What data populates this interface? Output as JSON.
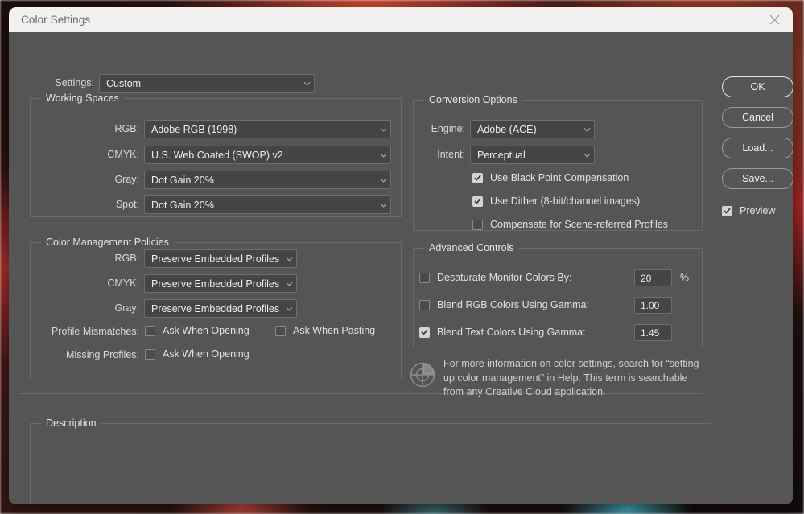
{
  "window": {
    "title": "Color Settings",
    "close_icon": "close-icon"
  },
  "settings_row": {
    "label": "Settings:",
    "value": "Custom"
  },
  "working_spaces": {
    "legend": "Working Spaces",
    "rows": [
      {
        "label": "RGB:",
        "value": "Adobe RGB (1998)"
      },
      {
        "label": "CMYK:",
        "value": "U.S. Web Coated (SWOP) v2"
      },
      {
        "label": "Gray:",
        "value": "Dot Gain 20%"
      },
      {
        "label": "Spot:",
        "value": "Dot Gain 20%"
      }
    ]
  },
  "color_management_policies": {
    "legend": "Color Management Policies",
    "rows": [
      {
        "label": "RGB:",
        "value": "Preserve Embedded Profiles"
      },
      {
        "label": "CMYK:",
        "value": "Preserve Embedded Profiles"
      },
      {
        "label": "Gray:",
        "value": "Preserve Embedded Profiles"
      }
    ],
    "profile_mismatches": {
      "label": "Profile Mismatches:",
      "ask_when_opening": {
        "label": "Ask When Opening",
        "checked": false
      },
      "ask_when_pasting": {
        "label": "Ask When Pasting",
        "checked": false
      }
    },
    "missing_profiles": {
      "label": "Missing Profiles:",
      "ask_when_opening": {
        "label": "Ask When Opening",
        "checked": false
      }
    }
  },
  "conversion_options": {
    "legend": "Conversion Options",
    "engine": {
      "label": "Engine:",
      "value": "Adobe (ACE)"
    },
    "intent": {
      "label": "Intent:",
      "value": "Perceptual"
    },
    "checks": [
      {
        "label": "Use Black Point Compensation",
        "checked": true
      },
      {
        "label": "Use Dither (8-bit/channel images)",
        "checked": true
      },
      {
        "label": "Compensate for Scene-referred Profiles",
        "checked": false
      }
    ]
  },
  "advanced_controls": {
    "legend": "Advanced Controls",
    "rows": [
      {
        "label": "Desaturate Monitor Colors By:",
        "checked": false,
        "value": "20",
        "unit": "%"
      },
      {
        "label": "Blend RGB Colors Using Gamma:",
        "checked": false,
        "value": "1.00",
        "unit": ""
      },
      {
        "label": "Blend Text Colors Using Gamma:",
        "checked": true,
        "value": "1.45",
        "unit": ""
      }
    ]
  },
  "info": {
    "icon": "color-target-icon",
    "text": "For more information on color settings, search for “setting up color management” in Help. This term is searchable from any Creative Cloud application."
  },
  "description": {
    "legend": "Description",
    "text": ""
  },
  "buttons": {
    "ok": "OK",
    "cancel": "Cancel",
    "load": "Load...",
    "save": "Save...",
    "preview": {
      "label": "Preview",
      "checked": true
    }
  },
  "colors": {
    "dialog_bg": "#555555",
    "titlebar_bg": "#f1f0ef",
    "field_bg": "#454545",
    "border": "#6a6a6a",
    "text": "#e2e2e2"
  }
}
